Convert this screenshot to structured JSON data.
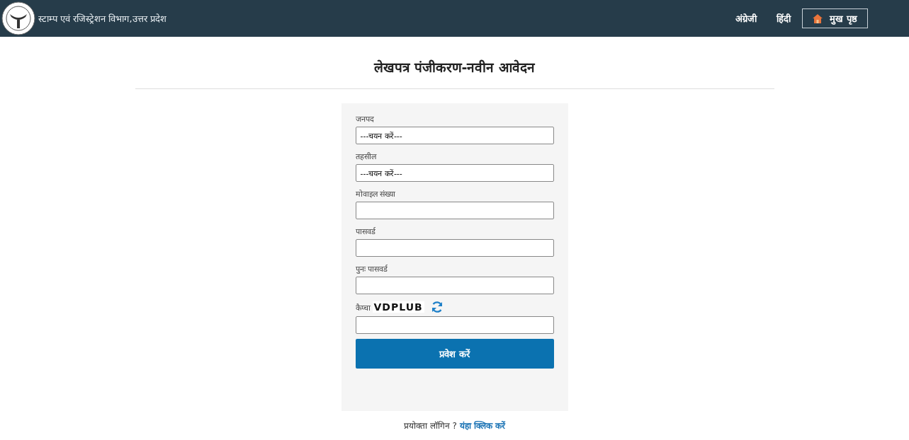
{
  "header": {
    "title": "स्टाम्प एवं रजिस्ट्रेशन विभाग,उत्तर प्रदेश",
    "links": [
      {
        "label": "अंग्रेजी",
        "kind": "link"
      },
      {
        "label": "हिंदी",
        "kind": "link"
      },
      {
        "label": "मुख पृष्ठ",
        "kind": "home"
      }
    ]
  },
  "page_title": "लेखपत्र पंजीकरण-नवीन आवेदन",
  "form": {
    "fields": [
      {
        "kind": "select",
        "label": "जनपद",
        "value": "---चयन करें---"
      },
      {
        "kind": "select",
        "label": "तहसील",
        "value": "---चयन करें---"
      },
      {
        "kind": "input",
        "label": "मोवाइल संख्या"
      },
      {
        "kind": "password",
        "label": "पासवर्ड"
      },
      {
        "kind": "password",
        "label": "पुनः पासवर्ड"
      },
      {
        "kind": "captcha",
        "label": "कैप्चा",
        "captcha": "VDPLUB"
      }
    ],
    "submit": "प्रवेश करें"
  },
  "footer": {
    "text": "प्रयोक्ता लॉगिन ?",
    "link": "यंहा क्लिक करें"
  }
}
